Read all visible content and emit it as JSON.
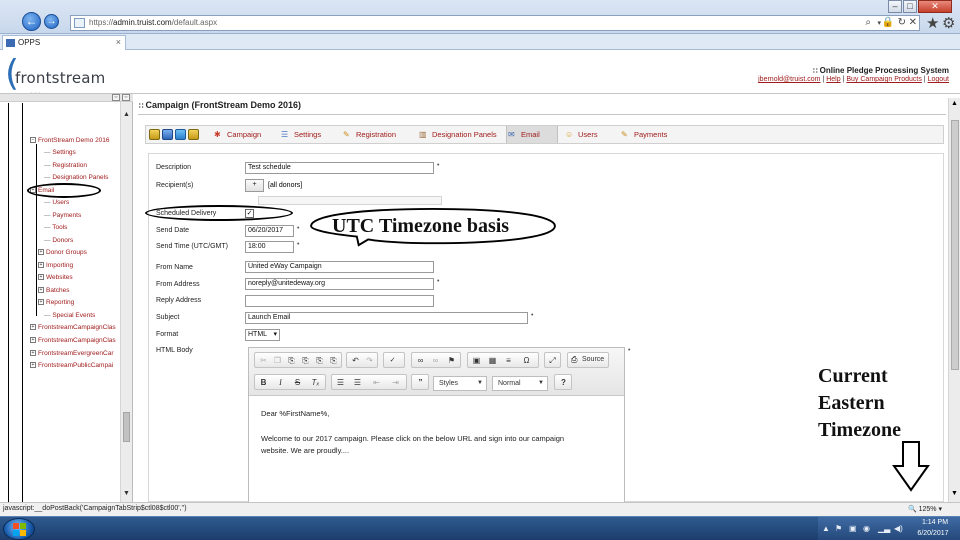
{
  "browser": {
    "url": "https://admin.truist.com/default.aspx",
    "url_scheme": "https://",
    "url_host": "admin.truist.com",
    "url_path": "/default.aspx",
    "tab_title": "OPPS",
    "zoom": "125%"
  },
  "header": {
    "logo_text": "frontstream",
    "system_name": "Online Pledge Processing System",
    "user": "jbernold@truist.com",
    "help": "Help",
    "buy": "Buy Campaign Products",
    "logout": "Logout",
    "sep": "|"
  },
  "sidebar": {
    "items": [
      {
        "label": "FrontStream Demo 2016",
        "expander": "⊟"
      },
      {
        "label": "Settings"
      },
      {
        "label": "Registration"
      },
      {
        "label": "Designation Panels"
      },
      {
        "label": "Email",
        "expander": "⊞"
      },
      {
        "label": "Users"
      },
      {
        "label": "Payments"
      },
      {
        "label": "Tools"
      },
      {
        "label": "Donors"
      },
      {
        "label": "Donor Groups",
        "expander": "⊞"
      },
      {
        "label": "Importing",
        "expander": "⊞"
      },
      {
        "label": "Websites",
        "expander": "⊞"
      },
      {
        "label": "Batches",
        "expander": "⊞"
      },
      {
        "label": "Reporting",
        "expander": "⊞"
      },
      {
        "label": "Special Events"
      },
      {
        "label": "FrontstreamCampaignClas",
        "expander": "⊞"
      },
      {
        "label": "FrontstreamCampaignClas",
        "expander": "⊞"
      },
      {
        "label": "FrontstreamEvergreenCar",
        "expander": "⊞"
      },
      {
        "label": "FrontstreamPublicCampai",
        "expander": "⊞"
      }
    ]
  },
  "main": {
    "title": "Campaign (FrontStream Demo 2016)",
    "tabs": [
      {
        "label": "Campaign",
        "icon": "campaign-icon"
      },
      {
        "label": "Settings",
        "icon": "settings-list-icon"
      },
      {
        "label": "Registration",
        "icon": "registration-icon"
      },
      {
        "label": "Designation Panels",
        "icon": "panels-icon"
      },
      {
        "label": "Email",
        "icon": "envelope-icon"
      },
      {
        "label": "Users",
        "icon": "user-icon"
      },
      {
        "label": "Payments",
        "icon": "payments-icon"
      }
    ]
  },
  "form": {
    "description_label": "Description",
    "description_value": "Test schedule",
    "recipients_label": "Recipient(s)",
    "recipients_btn": "+",
    "recipients_value": "[all donors]",
    "scheduled_label": "Scheduled Delivery",
    "scheduled_checked": true,
    "send_date_label": "Send Date",
    "send_date_value": "06/20/2017",
    "send_time_label": "Send Time (UTC/GMT)",
    "send_time_value": "18:00",
    "from_name_label": "From Name",
    "from_name_value": "United eWay Campaign",
    "from_address_label": "From Address",
    "from_address_value": "noreply@unitedeway.org",
    "reply_label": "Reply Address",
    "reply_value": "",
    "subject_label": "Subject",
    "subject_value": "Launch Email",
    "format_label": "Format",
    "format_value": "HTML",
    "body_label": "HTML Body",
    "req_marker": "•"
  },
  "editor": {
    "source_label": "Source",
    "styles_label": "Styles",
    "format_label": "Normal",
    "help_label": "?",
    "body_line1": "Dear %FirstName%,",
    "body_line2": "Welcome to our 2017 campaign.  Please click on the below URL and sign into our campaign",
    "body_line3": "website.  We are proudly...."
  },
  "annotations": {
    "utc": "UTC Timezone basis",
    "current_tz": [
      "Current",
      "Eastern",
      "Timezone"
    ]
  },
  "status": {
    "text": "javascript:__doPostBack('CampaignTabStrip$ctl08$ctl00','')"
  },
  "taskbar": {
    "time": "1:14 PM",
    "date": "6/20/2017"
  },
  "colors": {
    "link_red": "#a01c1c",
    "brand_blue": "#2d6fb6"
  }
}
